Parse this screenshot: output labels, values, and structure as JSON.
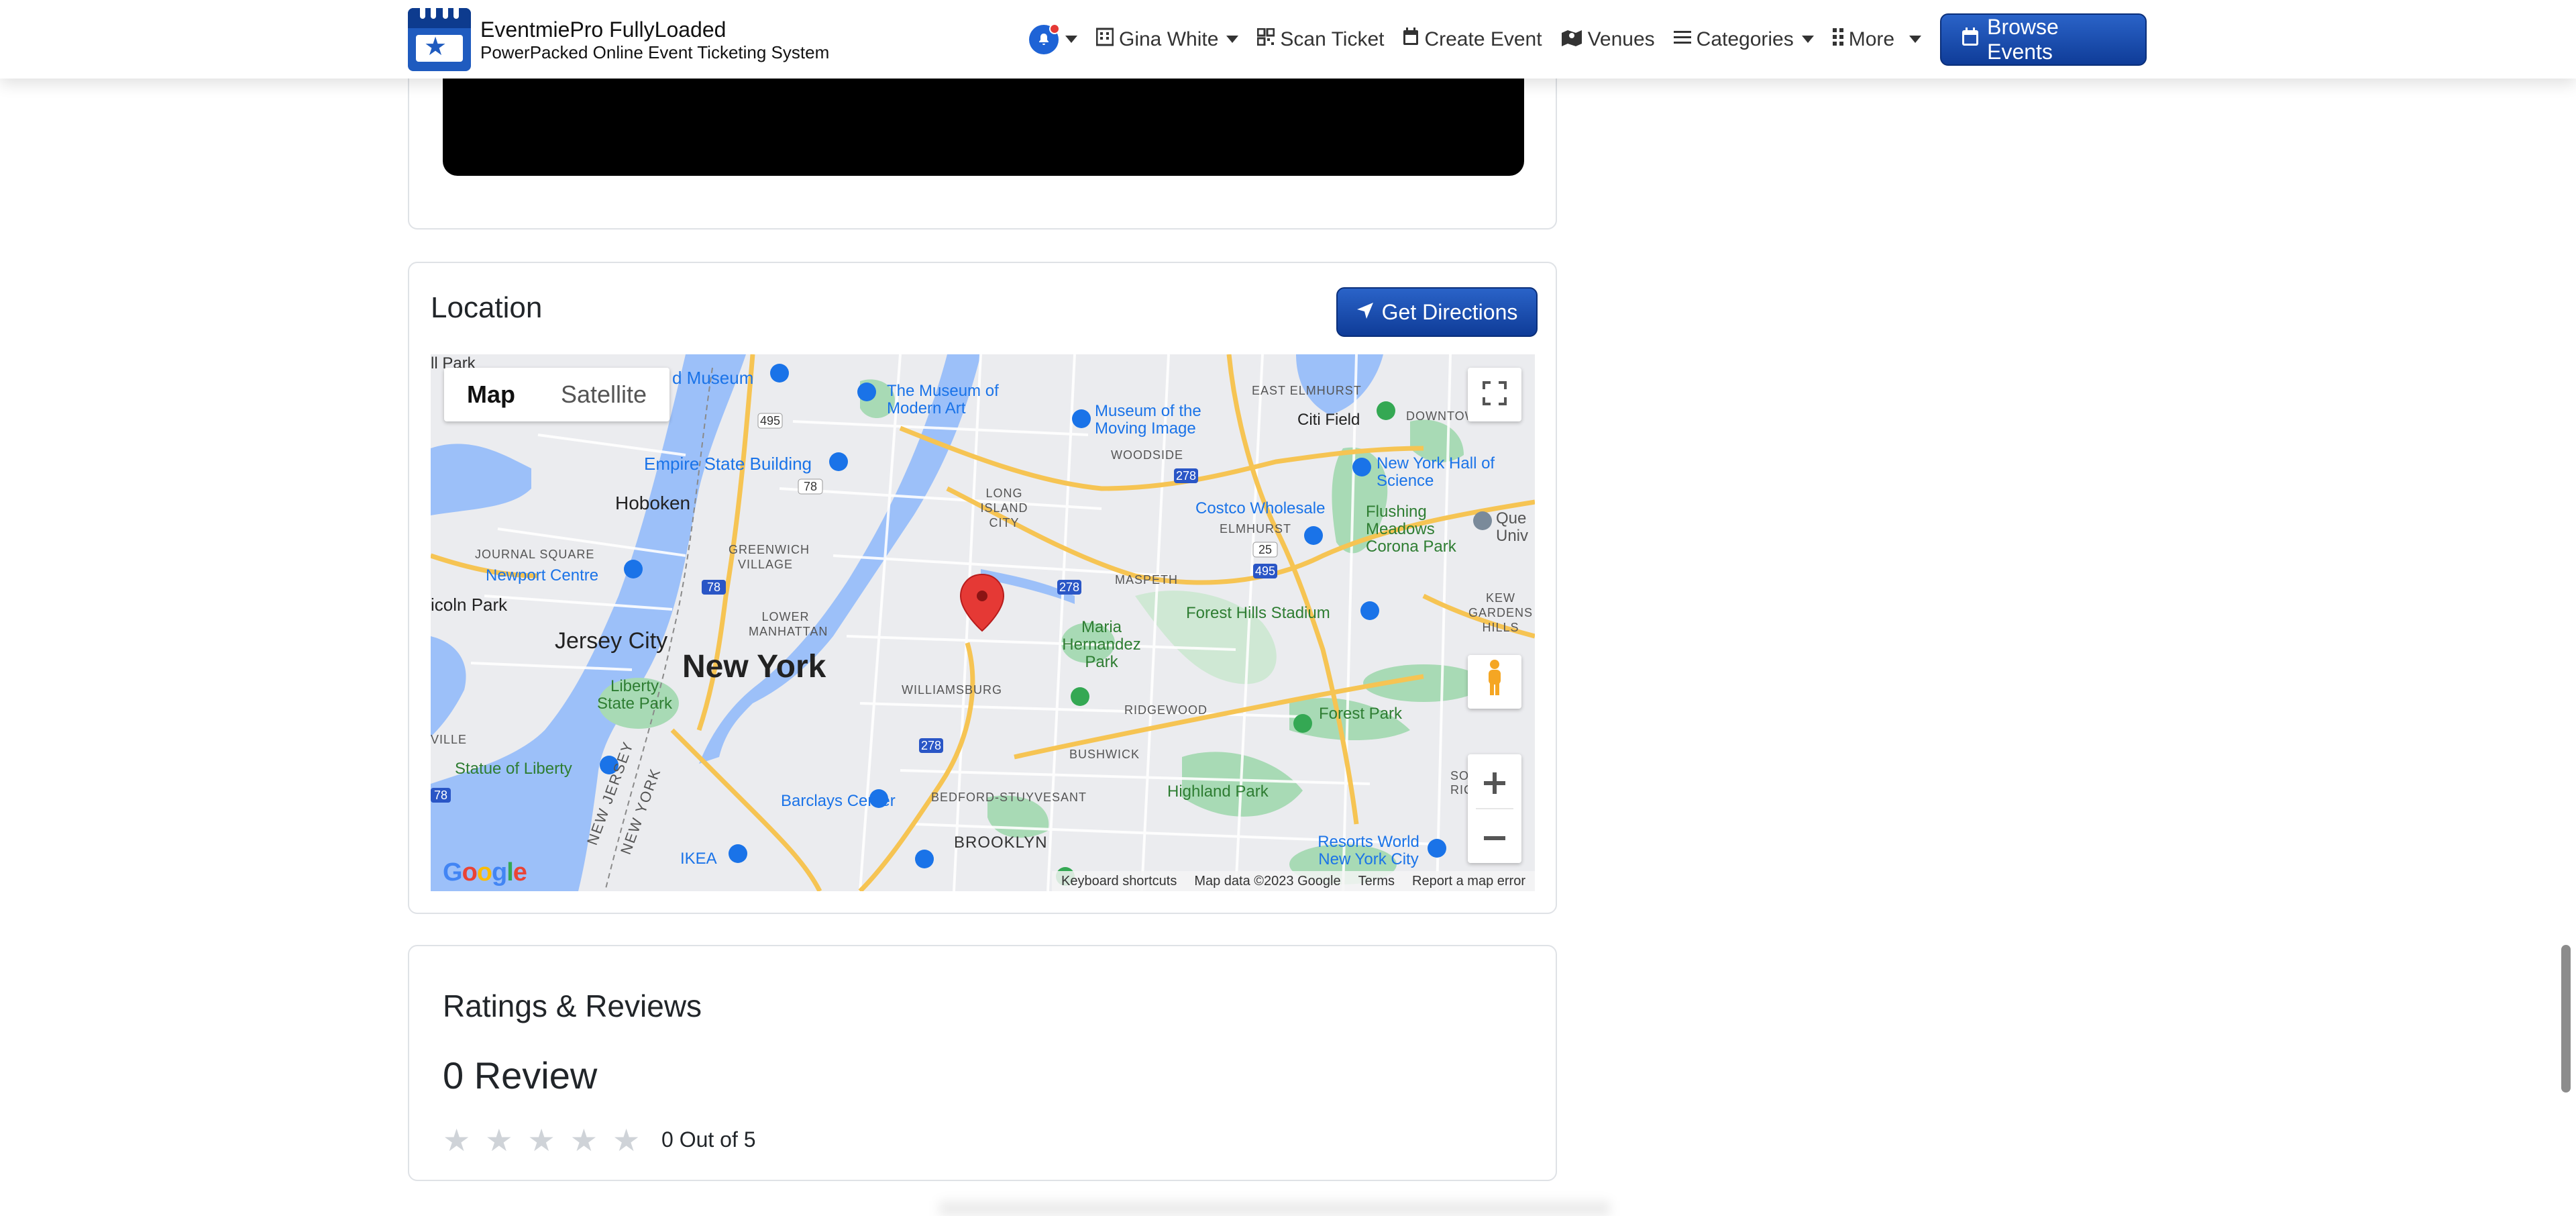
{
  "nav": {
    "brand_title": "EventmiePro FullyLoaded",
    "brand_subtitle": "PowerPacked Online Event Ticketing System",
    "user_name": "Gina White",
    "scan_ticket": "Scan Ticket",
    "create_event": "Create Event",
    "venues": "Venues",
    "categories": "Categories",
    "more": "More",
    "browse_events": "Browse Events"
  },
  "location": {
    "title": "Location",
    "get_directions": "Get Directions",
    "map_tabs": [
      "Map",
      "Satellite"
    ],
    "map_labels": {
      "new_york": "New York",
      "jersey_city": "Jersey City",
      "hoboken": "Hoboken",
      "brooklyn": "BROOKLYN",
      "empire_state": "Empire State Building",
      "moma": "The Museum of Modern Art",
      "moving_image": "Museum of the Moving Image",
      "citi_field": "Citi Field",
      "ny_hall_science": "New York Hall of Science",
      "costco": "Costco Wholesale",
      "flushing_meadows": "Flushing Meadows Corona Park",
      "newport_centre": "Newport Centre",
      "liberty_state_park": "Liberty State Park",
      "statue_liberty": "Statue of Liberty",
      "maria_hernandez": "Maria Hernandez Park",
      "forest_hills": "Forest Hills Stadium",
      "forest_park": "Forest Park",
      "highland_park": "Highland Park",
      "barclays": "Barclays Center",
      "ikea": "IKEA",
      "resorts_world": "Resorts World New York City",
      "williamsburg": "WILLIAMSBURG",
      "bushwick": "BUSHWICK",
      "ridgewood": "RIDGEWOOD",
      "bedford": "BEDFORD-STUYVESANT",
      "maspeth": "MASPETH",
      "elmhurst": "ELMHURST",
      "east_elmhurst": "EAST ELMHURST",
      "woodside": "WOODSIDE",
      "long_island_city": "LONG ISLAND CITY",
      "greenwich": "GREENWICH VILLAGE",
      "lower_manhattan": "LOWER MANHATTAN",
      "journal_square": "JOURNAL SQUARE",
      "kew_gardens": "KEW GARDENS HILLS",
      "downtown": "DOWNTOWN",
      "south_richmond": "SOUTH RICHMO",
      "new_jersey": "NEW JERSEY",
      "new_york_state": "NEW YORK",
      "lincoln_park": "icoln Park",
      "park_partial": "ll Park",
      "museum_partial": "d Museum",
      "queens_partial": "Que Univ",
      "ville": "VILLE"
    },
    "footer": [
      "Keyboard shortcuts",
      "Map data ©2023 Google",
      "Terms",
      "Report a map error"
    ],
    "google": [
      "G",
      "o",
      "o",
      "g",
      "l",
      "e"
    ]
  },
  "reviews": {
    "title": "Ratings & Reviews",
    "count": "0 Review",
    "rating_text": "0 Out of 5"
  },
  "colors": {
    "brand_blue": "#1f5bbf",
    "marker_red": "#e53935"
  }
}
